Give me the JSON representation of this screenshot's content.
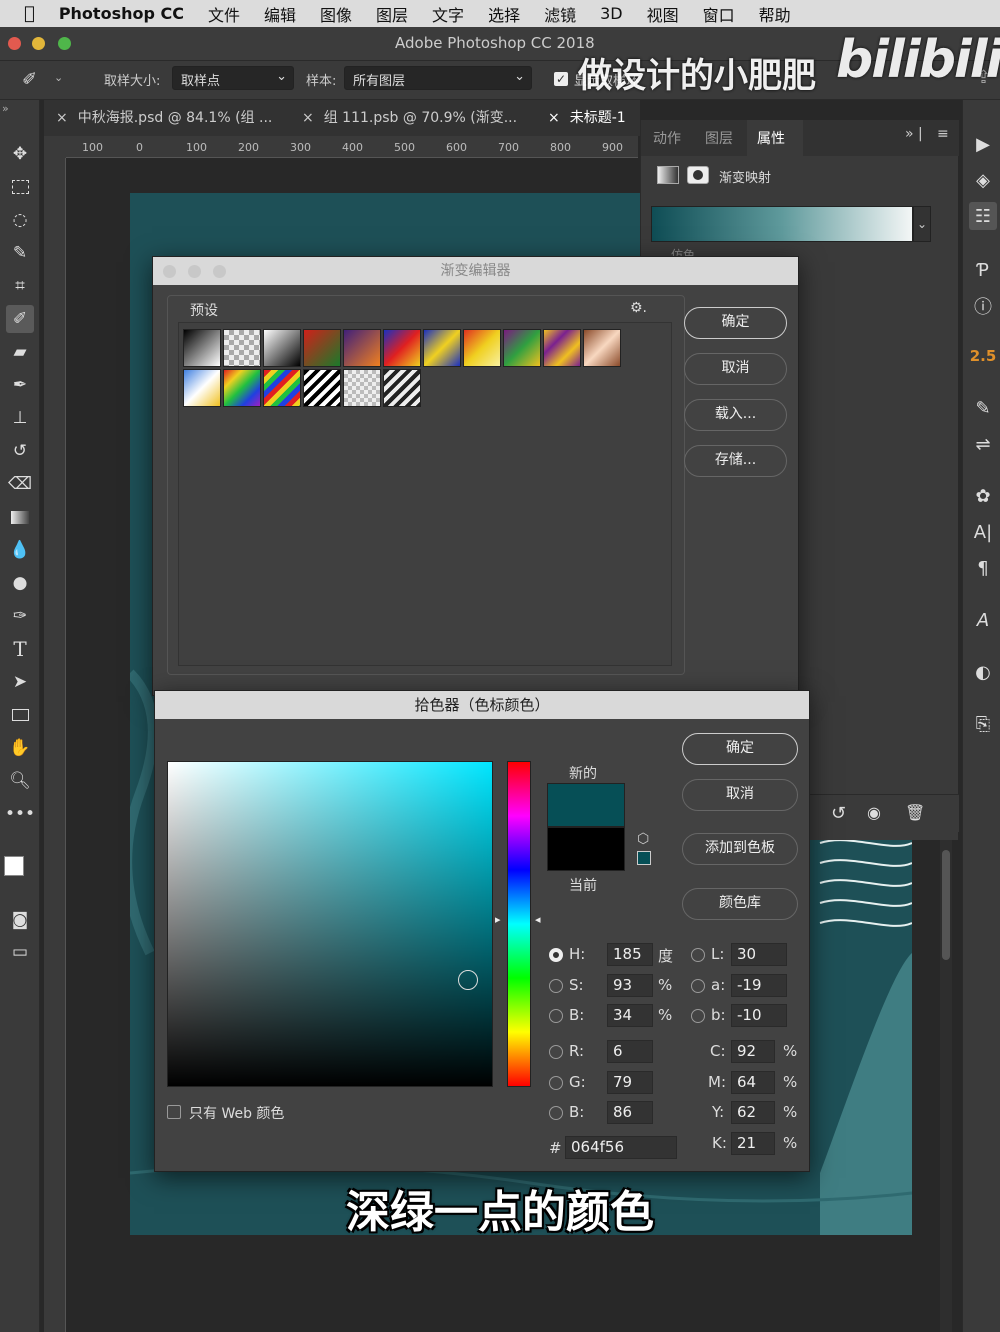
{
  "menubar": {
    "apple": "",
    "app": "Photoshop CC",
    "items": [
      "文件",
      "编辑",
      "图像",
      "图层",
      "文字",
      "选择",
      "滤镜",
      "3D",
      "视图",
      "窗口",
      "帮助"
    ]
  },
  "window": {
    "title": "Adobe Photoshop CC 2018"
  },
  "watermark": {
    "text": "做设计的小肥肥",
    "logo": "bilibili"
  },
  "options": {
    "sample_size_label": "取样大小:",
    "sample_size_value": "取样点",
    "sample_label": "样本:",
    "sample_value": "所有图层",
    "show_ring_label": "显示取样环"
  },
  "tabs": [
    {
      "label": "中秋海报.psd @ 84.1% (组 ..."
    },
    {
      "label": "组 111.psb @ 70.9% (渐变..."
    },
    {
      "label": "未标题-1"
    }
  ],
  "ruler": {
    "h_ticks": [
      "100",
      "0",
      "100",
      "200",
      "300",
      "400",
      "500",
      "600",
      "700",
      "800",
      "900"
    ]
  },
  "panel": {
    "tabs": [
      "动作",
      "图层",
      "属性"
    ],
    "layer_type": "渐变映射",
    "peek_label": "仿色"
  },
  "gradient_editor": {
    "title": "渐变编辑器",
    "presets_label": "预设",
    "buttons": {
      "ok": "确定",
      "cancel": "取消",
      "load": "载入...",
      "save": "存储..."
    }
  },
  "color_picker": {
    "title": "拾色器（色标颜色）",
    "new_label": "新的",
    "current_label": "当前",
    "buttons": {
      "ok": "确定",
      "cancel": "取消",
      "add": "添加到色板",
      "library": "颜色库"
    },
    "web_only": "只有 Web 颜色",
    "hsb": {
      "h_label": "H:",
      "h": "185",
      "h_unit": "度",
      "s_label": "S:",
      "s": "93",
      "s_unit": "%",
      "b_label": "B:",
      "b": "34",
      "b_unit": "%"
    },
    "lab": {
      "l_label": "L:",
      "l": "30",
      "a_label": "a:",
      "a": "-19",
      "b_label": "b:",
      "b": "-10"
    },
    "rgb": {
      "r_label": "R:",
      "r": "6",
      "g_label": "G:",
      "g": "79",
      "b_label": "B:",
      "b": "86"
    },
    "cmyk": {
      "c_label": "C:",
      "c": "92",
      "m_label": "M:",
      "m": "64",
      "y_label": "Y:",
      "y": "62",
      "k_label": "K:",
      "k": "21",
      "unit": "%"
    },
    "hex_label": "#",
    "hex": "064f56",
    "new_color": "#064f56",
    "current_color": "#000000"
  },
  "subtitle": "深绿一点的颜色",
  "right_value": "2.5"
}
